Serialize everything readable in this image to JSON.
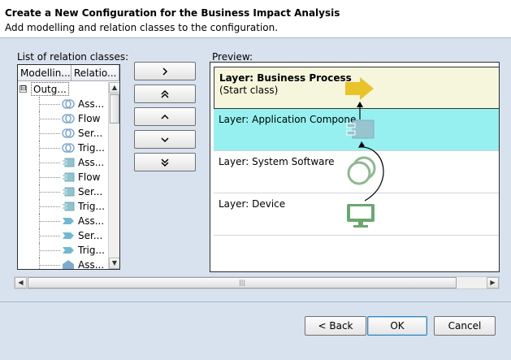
{
  "header": {
    "title": "Create a New Configuration for the Business Impact Analysis",
    "description": "Add modelling and relation classes to the configuration."
  },
  "left_panel": {
    "label": "List of relation classes:",
    "columns": [
      "Modellin...",
      "Relatio..."
    ],
    "root": {
      "expander": "⊟",
      "label": "Outg..."
    },
    "rows": [
      {
        "label": "Ass...",
        "icon": "circles-icon"
      },
      {
        "label": "Flow",
        "icon": "circles-icon"
      },
      {
        "label": "Ser...",
        "icon": "circles-icon"
      },
      {
        "label": "Trig...",
        "icon": "circles-icon"
      },
      {
        "label": "Ass...",
        "icon": "component-icon"
      },
      {
        "label": "Flow",
        "icon": "component-icon"
      },
      {
        "label": "Ser...",
        "icon": "component-icon"
      },
      {
        "label": "Trig...",
        "icon": "component-icon"
      },
      {
        "label": "Ass...",
        "icon": "tag-icon"
      },
      {
        "label": "Ser...",
        "icon": "tag-icon"
      },
      {
        "label": "Trig...",
        "icon": "tag-icon"
      },
      {
        "label": "Ass...",
        "icon": "house-icon"
      }
    ]
  },
  "middle_buttons": {
    "add": "›",
    "move_top": "«",
    "move_up": "‹",
    "move_down": "›",
    "move_bottom": "»"
  },
  "preview": {
    "label": "Preview:",
    "layers": [
      {
        "name": "Layer: Business Process",
        "sub": "(Start class)",
        "bg": "#f5f6dc"
      },
      {
        "name": "Layer: Application Compone...",
        "sub": "",
        "bg": "#96f0f0"
      },
      {
        "name": "Layer: System Software",
        "sub": "",
        "bg": "#ffffff"
      },
      {
        "name": "Layer: Device",
        "sub": "",
        "bg": "#ffffff"
      }
    ],
    "colors": {
      "process_arrow": "#e8c42a",
      "component": "#96c4cf",
      "system_software": "#8fb892",
      "device": "#6aa870"
    }
  },
  "buttons": {
    "back": "< Back",
    "ok": "OK",
    "cancel": "Cancel"
  }
}
